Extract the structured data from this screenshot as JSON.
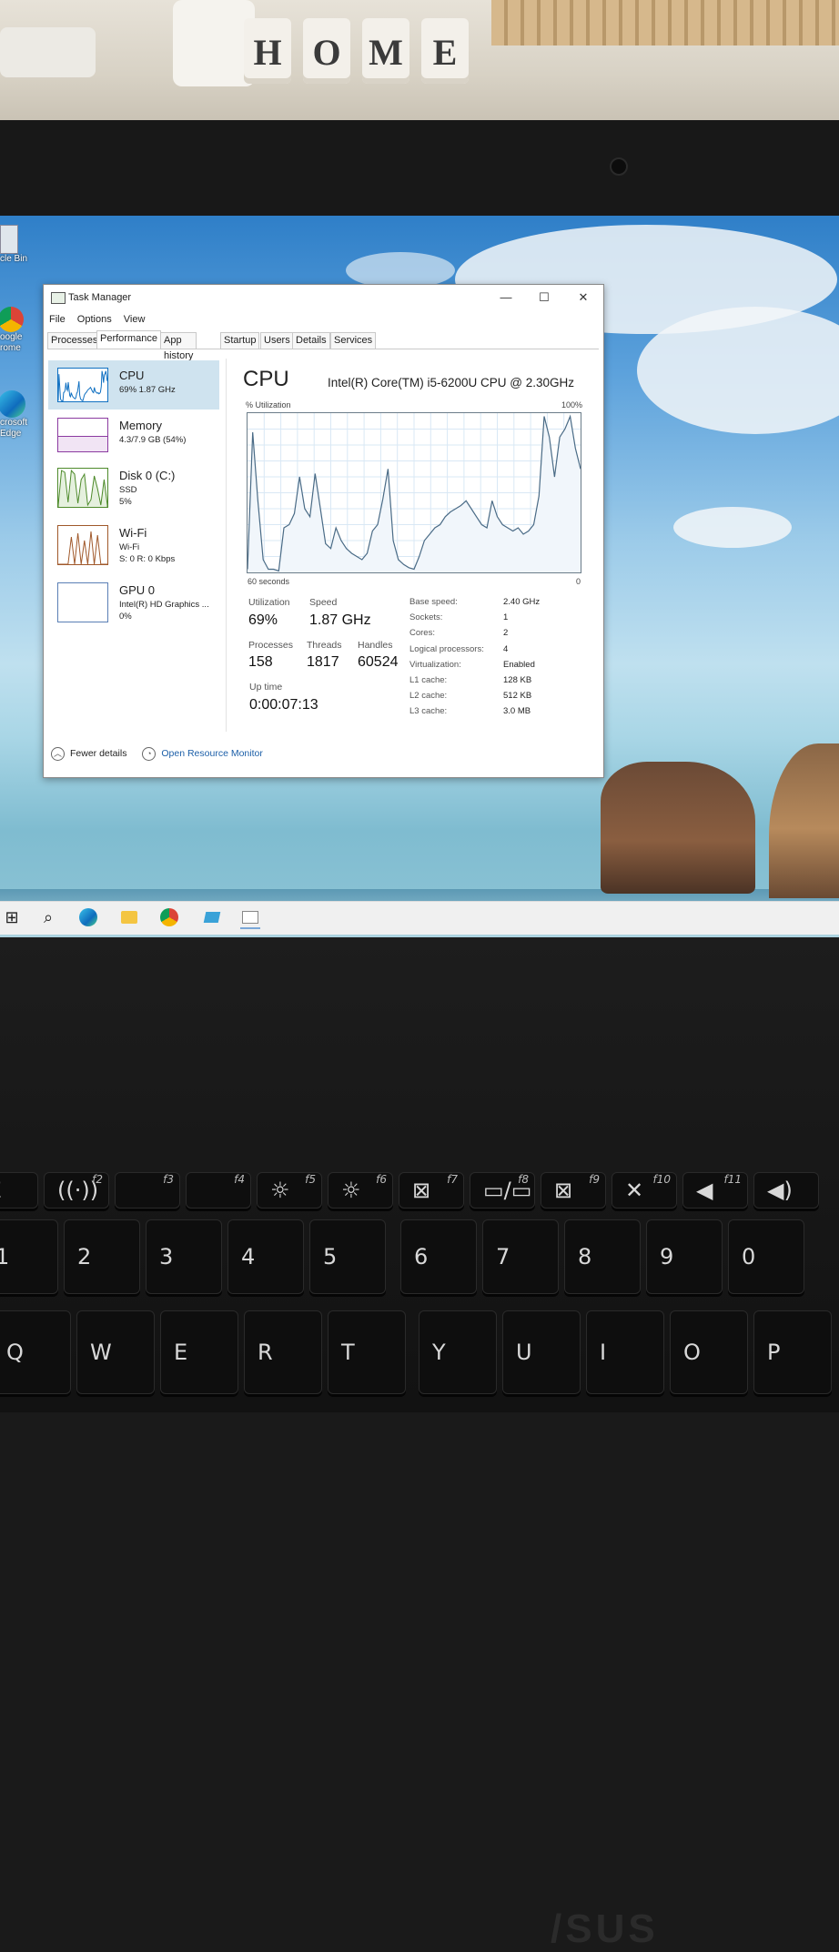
{
  "photo": {
    "candle_letters": [
      "H",
      "O",
      "M",
      "E"
    ],
    "laptop_brand": "/SUS"
  },
  "desktop": {
    "icons": [
      {
        "label": "cle Bin",
        "icon": "recycle-bin-icon"
      },
      {
        "label": "oogle\nrome",
        "icon": "chrome-icon"
      },
      {
        "label": "crosoft\nEdge",
        "icon": "edge-icon"
      }
    ]
  },
  "taskbar": {
    "icons": [
      "windows-start-icon",
      "search-icon",
      "edge-icon",
      "file-explorer-icon",
      "chrome-icon",
      "folder-blue-icon",
      "task-manager-icon"
    ]
  },
  "task_manager": {
    "title": "Task Manager",
    "window_buttons": {
      "minimize": "—",
      "maximize": "☐",
      "close": "✕"
    },
    "menu": [
      "File",
      "Options",
      "View"
    ],
    "tabs": [
      "Processes",
      "Performance",
      "App history",
      "Startup",
      "Users",
      "Details",
      "Services"
    ],
    "active_tab": "Performance",
    "sidebar": [
      {
        "name": "CPU",
        "sub1": "69% 1.87 GHz",
        "sub2": "",
        "sub3": "",
        "active": true
      },
      {
        "name": "Memory",
        "sub1": "4.3/7.9 GB (54%)",
        "sub2": "",
        "sub3": "",
        "active": false
      },
      {
        "name": "Disk 0 (C:)",
        "sub1": "SSD",
        "sub2": "5%",
        "sub3": "",
        "active": false
      },
      {
        "name": "Wi-Fi",
        "sub1": "Wi-Fi",
        "sub2": "S: 0 R: 0 Kbps",
        "sub3": "",
        "active": false
      },
      {
        "name": "GPU 0",
        "sub1": "Intel(R) HD Graphics ...",
        "sub2": "0%",
        "sub3": "",
        "active": false
      }
    ],
    "main": {
      "title": "CPU",
      "cpu_name": "Intel(R) Core(TM) i5-6200U CPU @ 2.30GHz",
      "graph_ylabel": "% Utilization",
      "graph_ymax": "100%",
      "graph_xlabel": "60 seconds",
      "graph_xmin": "0",
      "utilization_label": "Utilization",
      "utilization": "69%",
      "speed_label": "Speed",
      "speed": "1.87 GHz",
      "processes_label": "Processes",
      "processes": "158",
      "threads_label": "Threads",
      "threads": "1817",
      "handles_label": "Handles",
      "handles": "60524",
      "uptime_label": "Up time",
      "uptime": "0:00:07:13",
      "specs": [
        {
          "label": "Base speed:",
          "value": "2.40 GHz"
        },
        {
          "label": "Sockets:",
          "value": "1"
        },
        {
          "label": "Cores:",
          "value": "2"
        },
        {
          "label": "Logical processors:",
          "value": "4"
        },
        {
          "label": "Virtualization:",
          "value": "Enabled"
        },
        {
          "label": "L1 cache:",
          "value": "128 KB"
        },
        {
          "label": "L2 cache:",
          "value": "512 KB"
        },
        {
          "label": "L3 cache:",
          "value": "3.0 MB"
        }
      ]
    },
    "footer": {
      "fewer_details": "Fewer details",
      "resource_monitor": "Open Resource Monitor"
    },
    "cpu_history": [
      2,
      88,
      45,
      8,
      2,
      2,
      1,
      28,
      30,
      37,
      60,
      40,
      35,
      62,
      40,
      18,
      15,
      28,
      20,
      15,
      12,
      10,
      8,
      12,
      26,
      30,
      46,
      65,
      20,
      8,
      5,
      3,
      2,
      10,
      20,
      24,
      28,
      30,
      35,
      38,
      40,
      42,
      45,
      40,
      35,
      30,
      28,
      45,
      35,
      30,
      28,
      26,
      28,
      24,
      26,
      30,
      48,
      98,
      85,
      60,
      85,
      90,
      98,
      78,
      65
    ],
    "colors": {
      "accent": "#1171c2",
      "graph_line": "#1171c2",
      "selected": "#cfe3ef",
      "memory": "#8b3aa0",
      "disk": "#4d8a2a",
      "wifi": "#a0582a"
    }
  },
  "keyboard": {
    "frow": [
      {
        "main": "Z",
        "fn": ""
      },
      {
        "main": "((·))",
        "fn": "f2"
      },
      {
        "main": "",
        "fn": "f3"
      },
      {
        "main": "",
        "fn": "f4"
      },
      {
        "main": "☼",
        "fn": "f5"
      },
      {
        "main": "☼",
        "fn": "f6"
      },
      {
        "main": "⊠",
        "fn": "f7"
      },
      {
        "main": "▭/▭",
        "fn": "f8"
      },
      {
        "main": "⊠",
        "fn": "f9"
      },
      {
        "main": "✕",
        "fn": "f10"
      },
      {
        "main": "◀",
        "fn": "f11"
      },
      {
        "main": "◀)",
        "fn": ""
      }
    ],
    "num": [
      "1",
      "2",
      "3",
      "4",
      "5",
      "6",
      "7",
      "8",
      "9",
      "0"
    ],
    "alpha": [
      "Q",
      "W",
      "E",
      "R",
      "T",
      "Y",
      "U",
      "I",
      "O",
      "P"
    ]
  }
}
